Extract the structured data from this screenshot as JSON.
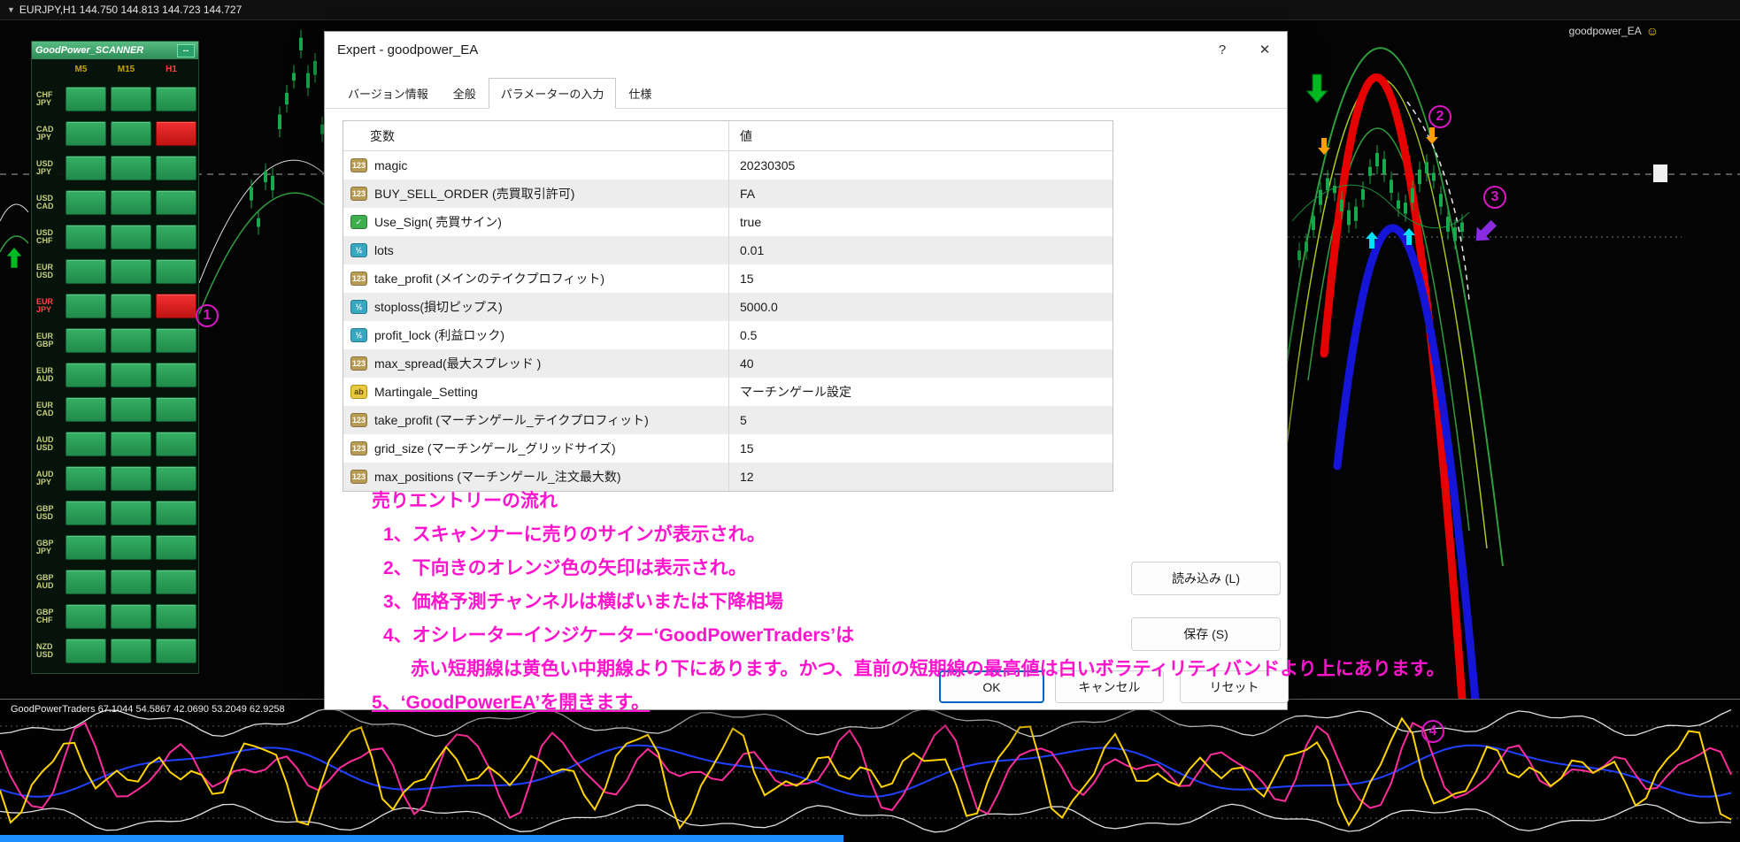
{
  "topbar": {
    "symbol_marker": "▼",
    "symbol_info": "EURJPY,H1  144.750 144.813 144.723 144.727",
    "ea_name": "goodpower_EA",
    "ea_smiley": "☺"
  },
  "scanner": {
    "title": "GoodPower_SCANNER",
    "minimize_label": "--",
    "columns": [
      "M5",
      "M15",
      "H1"
    ],
    "rows": [
      {
        "pair": "CHF JPY",
        "highlight": false,
        "cells": [
          "green",
          "green",
          "green"
        ]
      },
      {
        "pair": "CAD JPY",
        "highlight": false,
        "cells": [
          "green",
          "green",
          "red"
        ]
      },
      {
        "pair": "USD JPY",
        "highlight": false,
        "cells": [
          "green",
          "green",
          "green"
        ]
      },
      {
        "pair": "USD CAD",
        "highlight": false,
        "cells": [
          "green",
          "green",
          "green"
        ]
      },
      {
        "pair": "USD CHF",
        "highlight": false,
        "cells": [
          "green",
          "green",
          "green"
        ]
      },
      {
        "pair": "EUR USD",
        "highlight": false,
        "cells": [
          "green",
          "green",
          "green"
        ]
      },
      {
        "pair": "EUR JPY",
        "highlight": true,
        "cells": [
          "green",
          "green",
          "red"
        ]
      },
      {
        "pair": "EUR GBP",
        "highlight": false,
        "cells": [
          "green",
          "green",
          "green"
        ]
      },
      {
        "pair": "EUR AUD",
        "highlight": false,
        "cells": [
          "green",
          "green",
          "green"
        ]
      },
      {
        "pair": "EUR CAD",
        "highlight": false,
        "cells": [
          "green",
          "green",
          "green"
        ]
      },
      {
        "pair": "AUD USD",
        "highlight": false,
        "cells": [
          "green",
          "green",
          "green"
        ]
      },
      {
        "pair": "AUD JPY",
        "highlight": false,
        "cells": [
          "green",
          "green",
          "green"
        ]
      },
      {
        "pair": "GBP USD",
        "highlight": false,
        "cells": [
          "green",
          "green",
          "green"
        ]
      },
      {
        "pair": "GBP JPY",
        "highlight": false,
        "cells": [
          "green",
          "green",
          "green"
        ]
      },
      {
        "pair": "GBP AUD",
        "highlight": false,
        "cells": [
          "green",
          "green",
          "green"
        ]
      },
      {
        "pair": "GBP CHF",
        "highlight": false,
        "cells": [
          "green",
          "green",
          "green"
        ]
      },
      {
        "pair": "NZD USD",
        "highlight": false,
        "cells": [
          "green",
          "green",
          "green"
        ]
      }
    ]
  },
  "dialog": {
    "title": "Expert - goodpower_EA",
    "help_label": "?",
    "close_label": "✕",
    "tabs": [
      {
        "label": "バージョン情報"
      },
      {
        "label": "全般"
      },
      {
        "label": "パラメーターの入力"
      },
      {
        "label": "仕様"
      }
    ],
    "table": {
      "col_variable": "変数",
      "col_value": "値",
      "rows": [
        {
          "type": "int",
          "icon": "123",
          "name": "magic",
          "value": "20230305"
        },
        {
          "type": "int",
          "icon": "123",
          "name": "BUY_SELL_ORDER (売買取引許可)",
          "value": "FA"
        },
        {
          "type": "bool",
          "icon": "✓",
          "name": "Use_Sign( 売買サイン)",
          "value": "true"
        },
        {
          "type": "double",
          "icon": "½",
          "name": "lots",
          "value": "0.01"
        },
        {
          "type": "int",
          "icon": "123",
          "name": "take_profit (メインのテイクプロフィット)",
          "value": "15"
        },
        {
          "type": "double",
          "icon": "½",
          "name": "stoploss(損切ピップス)",
          "value": "5000.0"
        },
        {
          "type": "double",
          "icon": "½",
          "name": "profit_lock (利益ロック)",
          "value": "0.5"
        },
        {
          "type": "int",
          "icon": "123",
          "name": "max_spread(最大スプレッド )",
          "value": "40"
        },
        {
          "type": "string",
          "icon": "ab",
          "name": "Martingale_Setting",
          "value": "マーチンゲール設定"
        },
        {
          "type": "int",
          "icon": "123",
          "name": "take_profit (マーチンゲール_テイクプロフィット)",
          "value": "5"
        },
        {
          "type": "int",
          "icon": "123",
          "name": "grid_size (マーチンゲール_グリッドサイズ)",
          "value": "15"
        },
        {
          "type": "int",
          "icon": "123",
          "name": "max_positions (マーチンゲール_注文最大数)",
          "value": "12"
        }
      ]
    },
    "buttons": {
      "load": "読み込み (L)",
      "save": "保存 (S)",
      "ok": "OK",
      "cancel": "キャンセル",
      "reset": "リセット"
    }
  },
  "annotations": {
    "title": "売りエントリーの流れ",
    "steps": [
      "1、スキャンナーに売りのサインが表示され。",
      "2、下向きのオレンジ色の矢印は表示され。",
      "3、価格予測チャンネルは横ばいまたは下降相場",
      "4、オシレーターインジケーター‘GoodPowerTraders’は",
      "赤い短期線は黄色い中期線より下にあります。かつ、直前の短期線の最高値は白いボラティリティバンドより上にあります。",
      "5、‘GoodPowerEA’を開きます。"
    ],
    "markers": [
      "1",
      "2",
      "3",
      "4"
    ]
  },
  "oscillator": {
    "label": "GoodPowerTraders 67.1044 54.5867 42.0690 53.2049 62.9258"
  },
  "colors": {
    "signal_green": "#2ba158",
    "signal_red": "#e81c1c",
    "annotation_magenta": "#ff14ce",
    "prediction_band_red": "#e60000",
    "prediction_band_blue": "#1515d8",
    "oscillator_yellow": "#ffd400",
    "oscillator_short": "#ff2d9b",
    "volatility_band_white": "#e0e0e0"
  }
}
